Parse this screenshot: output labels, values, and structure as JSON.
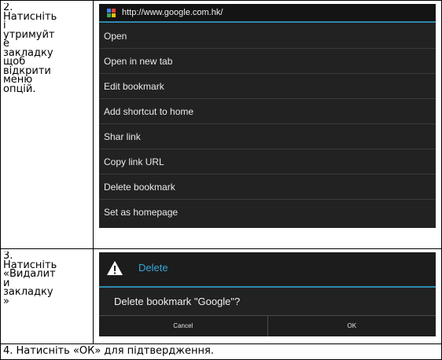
{
  "steps": {
    "step2": "2.\nНатисніть\nі\nутримуйт\nе\nзакладку\nщоб\nвідкрити\nменю\nопцій.",
    "step3": "3.\nНатисніть\n«Видалит\nи\nзакладку\n»",
    "step4": "4. Натисніть «ОК» для підтвердження."
  },
  "context_menu": {
    "url": "http://www.google.com.hk/",
    "favicon": "google-favicon-icon",
    "items": [
      "Open",
      "Open in new tab",
      "Edit bookmark",
      "Add shortcut to home",
      "Shar link",
      "Copy link URL",
      "Delete bookmark",
      "Set as homepage"
    ]
  },
  "dialog": {
    "icon": "warning-icon",
    "title": "Delete",
    "message": "Delete bookmark \"Google\"?",
    "cancel": "Cancel",
    "ok": "OK"
  },
  "colors": {
    "accent": "#2e8ab0",
    "dialog_title": "#35a7d8",
    "dark_bg": "#222222"
  }
}
